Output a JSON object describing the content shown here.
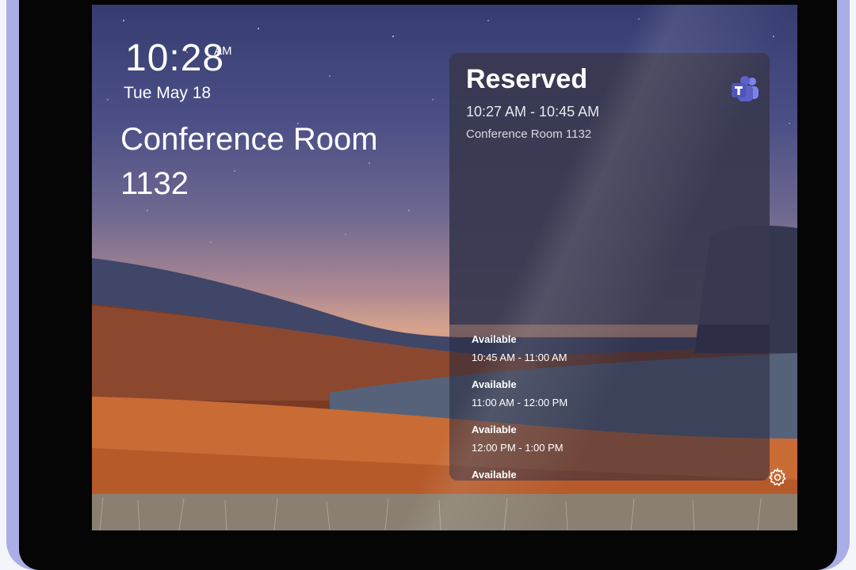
{
  "clock": {
    "time": "10:28",
    "ampm": "AM",
    "date": "Tue May 18"
  },
  "room": {
    "name_line1": "Conference Room",
    "name_line2": "1132"
  },
  "current_meeting": {
    "status": "Reserved",
    "time_range": "10:27 AM - 10:45 AM",
    "location": "Conference Room 1132"
  },
  "upcoming_slots": [
    {
      "status": "Available",
      "time_range": "10:45 AM - 11:00 AM"
    },
    {
      "status": "Available",
      "time_range": "11:00 AM - 12:00 PM"
    },
    {
      "status": "Available",
      "time_range": "12:00 PM - 1:00 PM"
    },
    {
      "status": "Available",
      "time_range": ""
    }
  ],
  "icons": {
    "app_logo": "microsoft-teams-icon",
    "settings": "gear-icon"
  },
  "colors": {
    "teams_purple": "#5b5fc7",
    "device_frame": "#a9aee6"
  }
}
